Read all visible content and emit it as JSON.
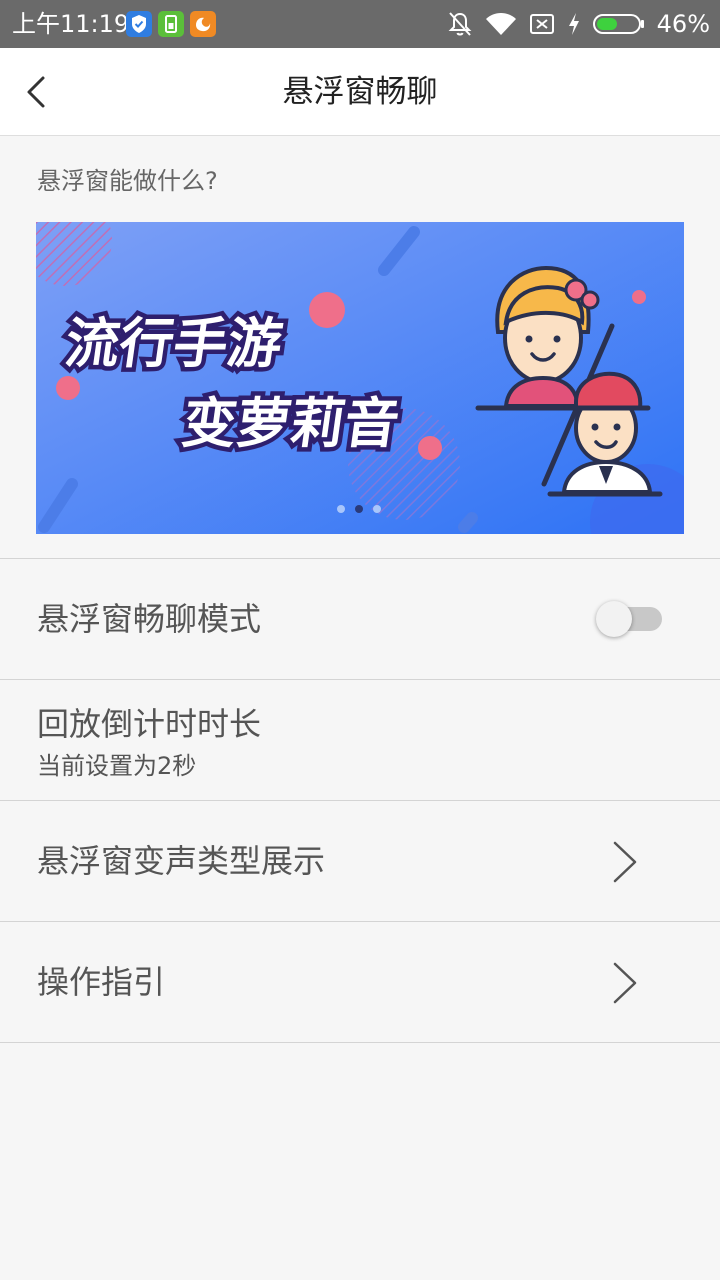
{
  "status_bar": {
    "time": "上午11:19",
    "battery": "46%",
    "app_icons": [
      "shield-app-icon",
      "sim-app-icon",
      "uc-browser-icon"
    ],
    "icons": [
      "mute-bell-icon",
      "wifi-icon",
      "no-sim-icon",
      "charging-icon",
      "battery-icon"
    ]
  },
  "nav": {
    "title": "悬浮窗畅聊"
  },
  "intro": {
    "label": "悬浮窗能做什么?"
  },
  "banner": {
    "line1": "流行手游",
    "line2": "变萝莉音",
    "page_count": 3,
    "active_page": 2
  },
  "settings": {
    "float_chat_mode": {
      "label": "悬浮窗畅聊模式",
      "enabled": false
    },
    "playback_countdown": {
      "label": "回放倒计时时长",
      "sub": "当前设置为2秒"
    },
    "voice_types": {
      "label": "悬浮窗变声类型展示"
    },
    "guide": {
      "label": "操作指引"
    }
  },
  "colors": {
    "status_bar": "#6a6a6a",
    "background": "#f6f6f6",
    "banner_blue": "#4f8bf6",
    "battery_green": "#3ed13e"
  }
}
